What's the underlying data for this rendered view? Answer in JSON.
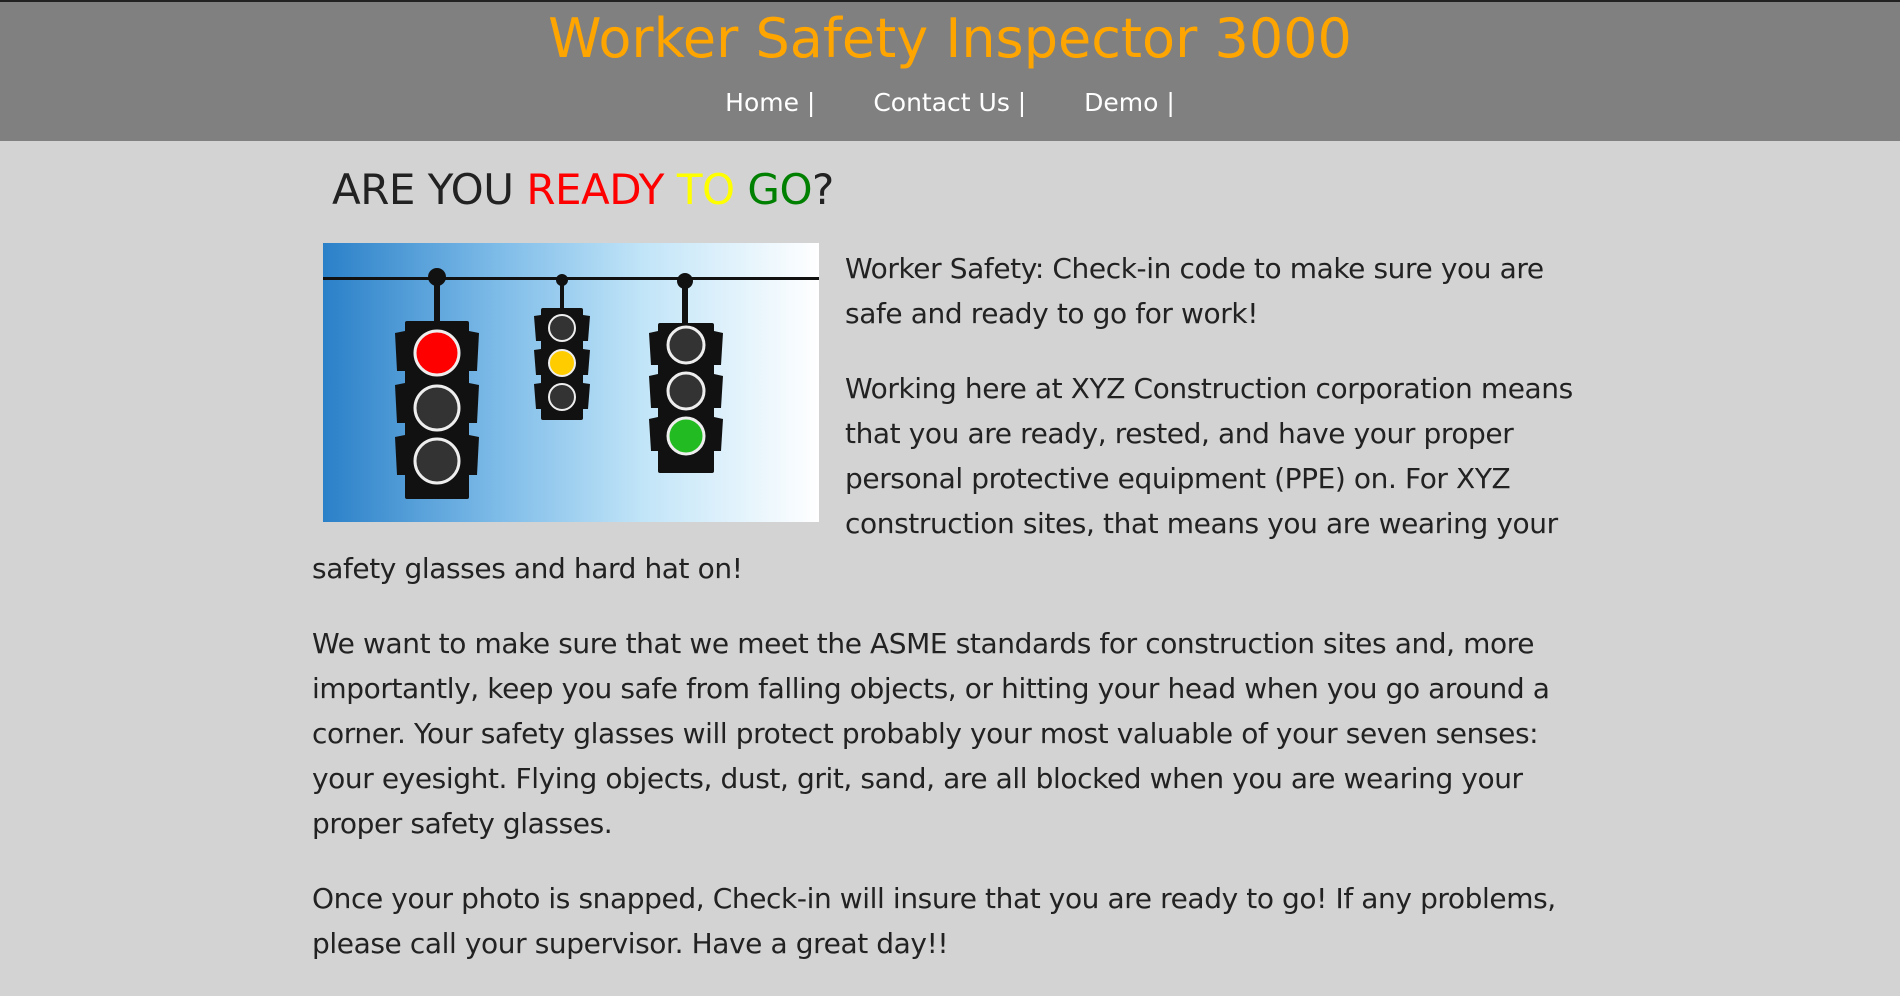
{
  "header": {
    "title": "Worker Safety Inspector 3000",
    "nav": [
      {
        "label": "Home |"
      },
      {
        "label": "Contact Us |"
      },
      {
        "label": "Demo |"
      }
    ]
  },
  "headline": {
    "part1": "ARE YOU ",
    "ready": "READY",
    "to": "TO",
    "go": "GO",
    "end": "?",
    "colors": {
      "ready": "#ff0000",
      "to": "#ffff00",
      "go": "#008000"
    }
  },
  "hero_image": {
    "icon": "traffic-lights-illustration"
  },
  "paragraphs": [
    "Worker Safety: Check-in code to make sure you are safe and ready to go for work!",
    "Working here at XYZ Construction corporation means that you are ready, rested, and have your proper personal protective equipment (PPE) on. For XYZ construction sites, that means you are wearing your safety glasses and hard hat on!",
    "We want to make sure that we meet the ASME standards for construction sites and, more importantly, keep you safe from falling objects, or hitting your head when you go around a corner. Your safety glasses will protect probably your most valuable of your seven senses: your eyesight. Flying objects, dust, grit, sand, are all blocked when you are wearing your proper safety glasses.",
    "Once your photo is snapped, Check-in will insure that you are ready to go! If any problems, please call your supervisor. Have a great day!!"
  ],
  "colors": {
    "header_bg": "#808080",
    "title": "#ffa500",
    "page_bg": "#d3d3d3"
  }
}
